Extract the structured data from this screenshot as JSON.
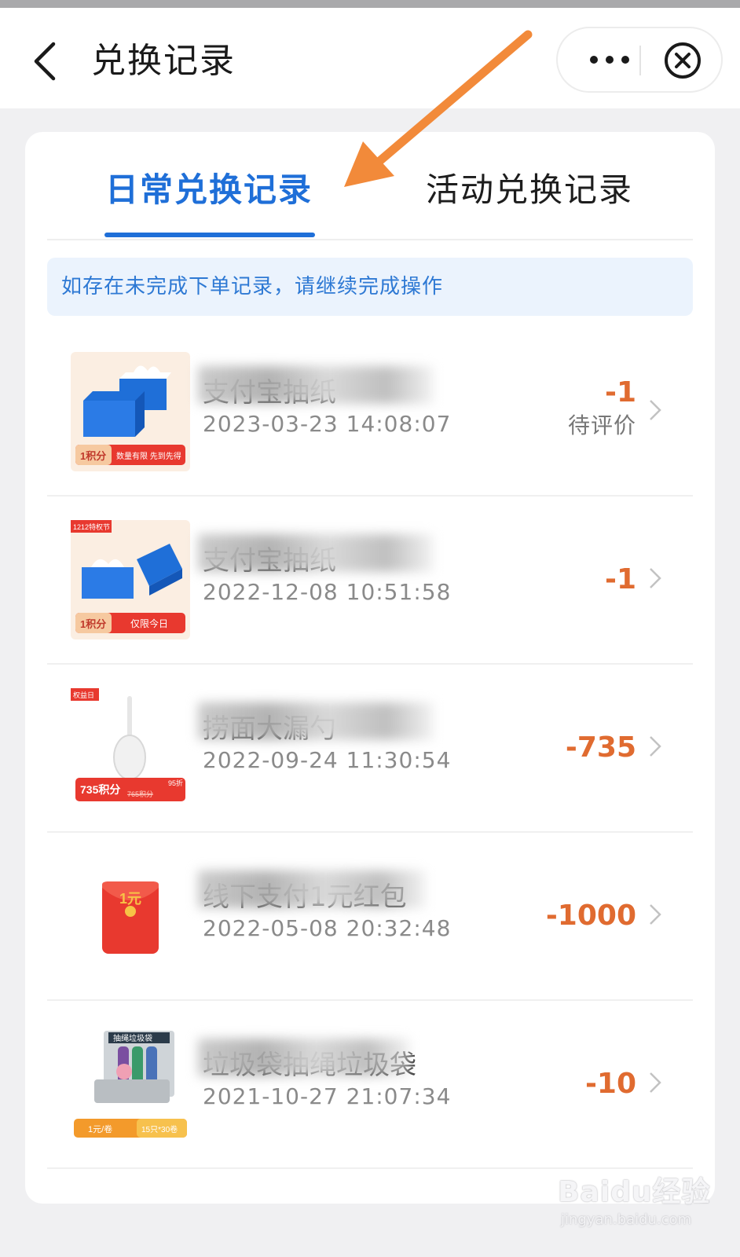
{
  "header": {
    "title": "兑换记录",
    "more_label": "•••"
  },
  "tabs": [
    {
      "label": "日常兑换记录",
      "active": true
    },
    {
      "label": "活动兑换记录",
      "active": false
    }
  ],
  "notice": "如存在未完成下单记录，请继续完成操作",
  "records": [
    {
      "name": "支付宝抽纸",
      "datetime": "2023-03-23 14:08:07",
      "points": "-1",
      "status": "待评价",
      "thumb_badge_left": "1积分",
      "thumb_badge_right": "数量有限 先到先得"
    },
    {
      "name": "支付宝抽纸",
      "datetime": "2022-12-08 10:51:58",
      "points": "-1",
      "status": "",
      "thumb_corner": "1212特权节",
      "thumb_badge_left": "1积分",
      "thumb_badge_right": "仅限今日"
    },
    {
      "name": "捞面大漏勺",
      "datetime": "2022-09-24 11:30:54",
      "points": "-735",
      "status": "",
      "thumb_corner": "权益日",
      "thumb_badge_left": "735积分",
      "thumb_badge_strike": "765积分",
      "thumb_badge_right": "95折"
    },
    {
      "name": "线下支付1元红包",
      "datetime": "2022-05-08 20:32:48",
      "points": "-1000",
      "status": "",
      "thumb_envelope_text": "1元"
    },
    {
      "name": "垃圾袋抽绳垃圾袋",
      "datetime": "2021-10-27 21:07:34",
      "points": "-10",
      "status": "",
      "thumb_bag_label": "抽绳垃圾袋",
      "thumb_badge_left": "1元/卷",
      "thumb_badge_right": "15只*30卷"
    }
  ],
  "watermark": {
    "logo": "Baidu经验",
    "url": "jingyan.baidu.com"
  },
  "colors": {
    "accent_blue": "#1f6fd8",
    "points_orange": "#e06b30",
    "annotation_arrow": "#f28a3a"
  }
}
